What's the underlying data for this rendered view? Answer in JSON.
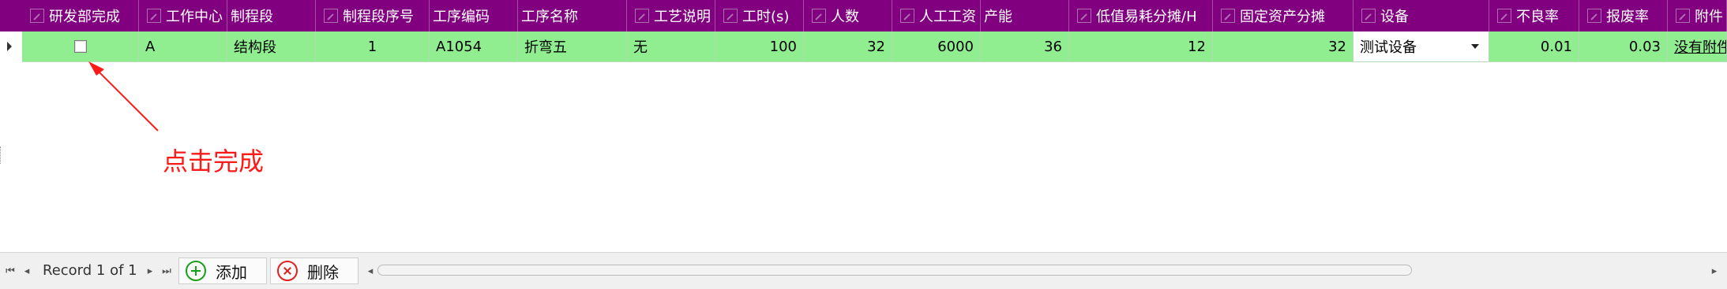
{
  "columns": [
    {
      "label": "研发部完成",
      "icon": "edit-icon"
    },
    {
      "label": "工作中心",
      "icon": "edit-icon"
    },
    {
      "label": "制程段",
      "icon": ""
    },
    {
      "label": "制程段序号",
      "icon": "edit-icon"
    },
    {
      "label": "工序编码",
      "icon": ""
    },
    {
      "label": "工序名称",
      "icon": ""
    },
    {
      "label": "工艺说明",
      "icon": "edit-icon"
    },
    {
      "label": "工时(s)",
      "icon": "edit-icon"
    },
    {
      "label": "人数",
      "icon": "edit-icon"
    },
    {
      "label": "人工工资",
      "icon": "edit-icon"
    },
    {
      "label": "产能",
      "icon": ""
    },
    {
      "label": "低值易耗分摊/H",
      "icon": "edit-icon"
    },
    {
      "label": "固定资产分摊",
      "icon": "edit-icon"
    },
    {
      "label": "设备",
      "icon": "edit-icon"
    },
    {
      "label": "不良率",
      "icon": "edit-icon"
    },
    {
      "label": "报废率",
      "icon": "edit-icon"
    },
    {
      "label": "附件",
      "icon": "edit-icon"
    }
  ],
  "row": {
    "done_checked": false,
    "work_center": "A",
    "process_segment": "结构段",
    "segment_no": "1",
    "op_code": "A1054",
    "op_name": "折弯五",
    "craft_desc": "无",
    "hours": "100",
    "people": "32",
    "wage": "6000",
    "capacity": "36",
    "consumables": "12",
    "fixed_assets": "32",
    "device": "测试设备",
    "defect_rate": "0.01",
    "scrap_rate": "0.03",
    "attachment": "没有附件"
  },
  "annotation": {
    "text": "点击完成",
    "color": "#ff1a1a"
  },
  "navigator": {
    "record_text": "Record 1 of 1"
  },
  "buttons": {
    "add": "添加",
    "delete": "删除"
  },
  "colors": {
    "header": "#800080",
    "row": "#90ee90",
    "add": "#1a9e1a",
    "delete": "#e02020"
  }
}
